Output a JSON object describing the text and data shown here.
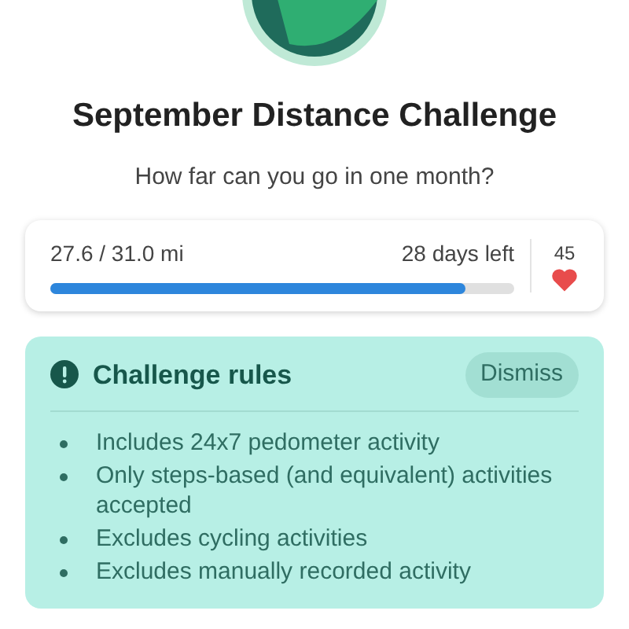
{
  "challenge": {
    "title": "September Distance Challenge",
    "subtitle": "How far can you go in one month?"
  },
  "progress": {
    "distance": "27.6 / 31.0 mi",
    "remaining": "28 days left",
    "level": 0.895,
    "likes": "45"
  },
  "rules": {
    "title": "Challenge rules",
    "dismiss": "Dismiss",
    "items": [
      "Includes 24x7 pedometer activity",
      "Only steps-based (and equivalent) activities accepted",
      "Excludes cycling activities",
      "Excludes manually recorded activity"
    ]
  }
}
